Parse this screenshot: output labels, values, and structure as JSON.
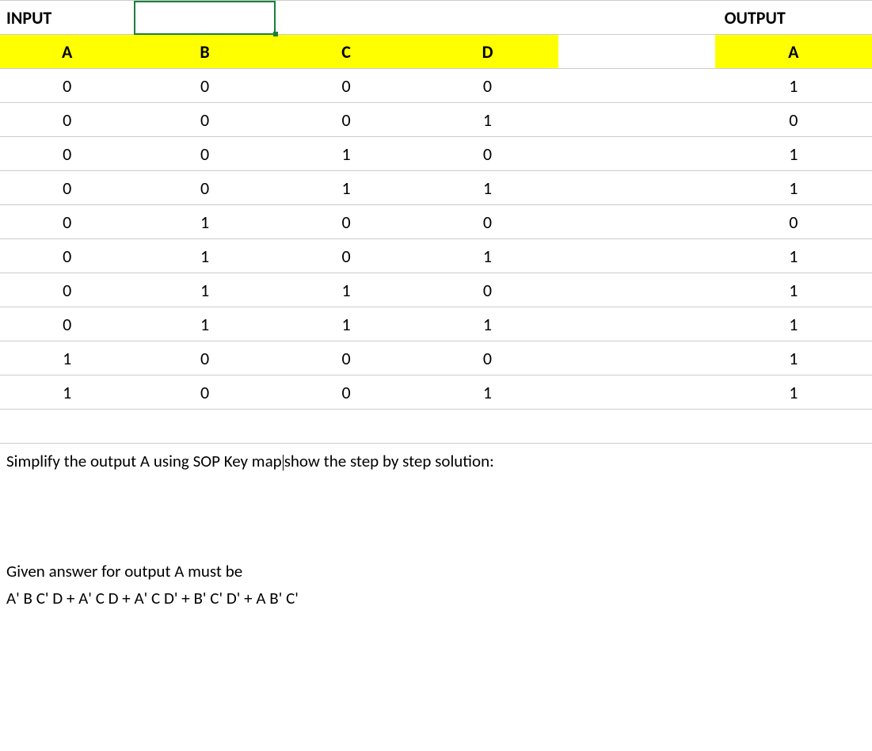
{
  "titles": {
    "input": "INPUT",
    "output": "OUTPUT"
  },
  "headers": {
    "a": "A",
    "b": "B",
    "c": "C",
    "d": "D",
    "out": "A"
  },
  "rows": [
    {
      "a": "0",
      "b": "0",
      "c": "0",
      "d": "0",
      "out": "1"
    },
    {
      "a": "0",
      "b": "0",
      "c": "0",
      "d": "1",
      "out": "0"
    },
    {
      "a": "0",
      "b": "0",
      "c": "1",
      "d": "0",
      "out": "1"
    },
    {
      "a": "0",
      "b": "0",
      "c": "1",
      "d": "1",
      "out": "1"
    },
    {
      "a": "0",
      "b": "1",
      "c": "0",
      "d": "0",
      "out": "0"
    },
    {
      "a": "0",
      "b": "1",
      "c": "0",
      "d": "1",
      "out": "1"
    },
    {
      "a": "0",
      "b": "1",
      "c": "1",
      "d": "0",
      "out": "1"
    },
    {
      "a": "0",
      "b": "1",
      "c": "1",
      "d": "1",
      "out": "1"
    },
    {
      "a": "1",
      "b": "0",
      "c": "0",
      "d": "0",
      "out": "1"
    },
    {
      "a": "1",
      "b": "0",
      "c": "0",
      "d": "1",
      "out": "1"
    }
  ],
  "question": {
    "part1": "Simplify the output A using SOP Key map",
    "part2": "show the step by step solution:"
  },
  "answer": {
    "label": "Given answer for output A must be",
    "expr": "A' B C' D + A' C D + A' C D' +  B' C' D' + A B' C'"
  }
}
